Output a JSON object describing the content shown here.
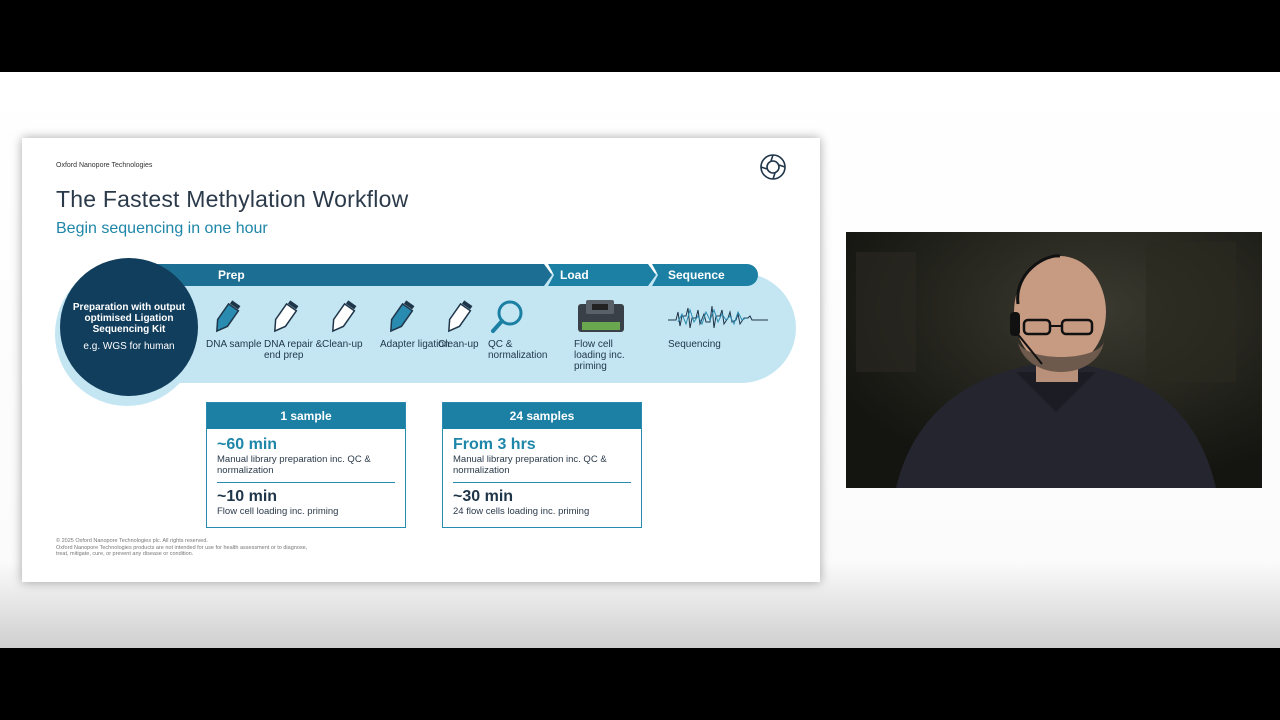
{
  "slide": {
    "company": "Oxford Nanopore Technologies",
    "title": "The Fastest Methylation Workflow",
    "subtitle": "Begin sequencing in one hour",
    "circle": {
      "title": "Preparation with output optimised Ligation Sequencing Kit",
      "sub": "e.g. WGS for human"
    },
    "bands": {
      "prep": "Prep",
      "load": "Load",
      "sequence": "Sequence"
    },
    "steps": [
      {
        "label": "DNA sample",
        "icon": "tube-icon"
      },
      {
        "label": "DNA repair & end prep",
        "icon": "tube-icon"
      },
      {
        "label": "Clean-up",
        "icon": "tube-icon"
      },
      {
        "label": "Adapter ligation",
        "icon": "tube-icon"
      },
      {
        "label": "Clean-up",
        "icon": "tube-icon"
      },
      {
        "label": "QC & normalization",
        "icon": "magnifier-icon"
      },
      {
        "label": "Flow cell loading inc. priming",
        "icon": "flow-cell-icon"
      },
      {
        "label": "Sequencing",
        "icon": "signal-trace-icon"
      }
    ],
    "boxes": [
      {
        "header": "1  sample",
        "time1": "~60 min",
        "desc1": "Manual library preparation inc. QC & normalization",
        "time2": "~10 min",
        "desc2": "Flow cell loading inc. priming"
      },
      {
        "header": "24  samples",
        "time1": "From 3 hrs",
        "desc1": "Manual library preparation inc. QC & normalization",
        "time2": "~30 min",
        "desc2": "24 flow cells loading inc. priming"
      }
    ],
    "footer": {
      "line1": "© 2025 Oxford Nanopore Technologies plc. All rights reserved.",
      "line2": "Oxford Nanopore Technologies products are not intended for use for health assessment or to diagnose, treat, mitigate, cure, or prevent any disease or condition."
    }
  },
  "colors": {
    "dark": "#123e5d",
    "teal": "#1c7fa4",
    "light": "#c4e6f3"
  }
}
